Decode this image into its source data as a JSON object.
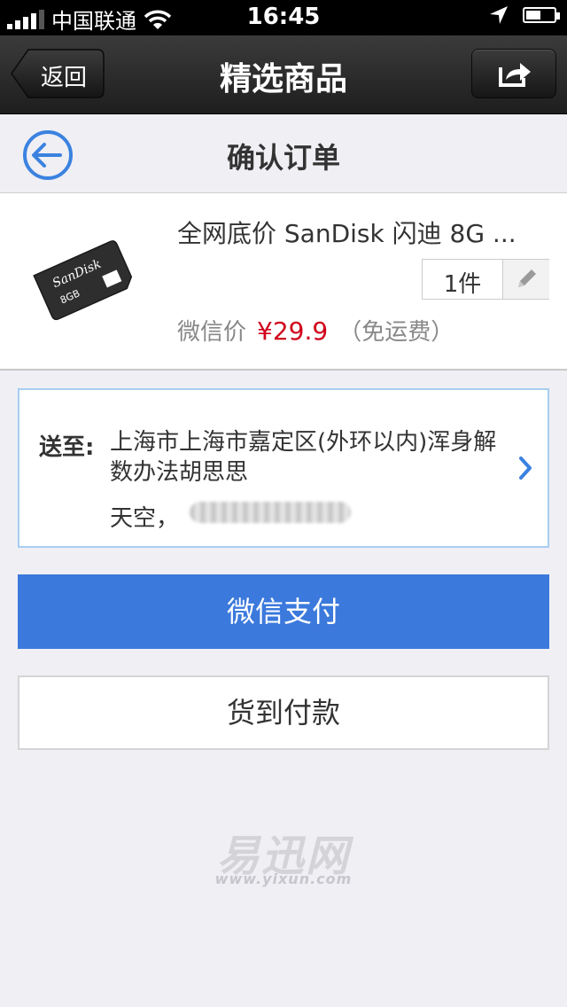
{
  "status_bar": {
    "carrier": "中国联通",
    "time": "16:45"
  },
  "nav": {
    "back_label": "返回",
    "title": "精选商品"
  },
  "header": {
    "title": "确认订单"
  },
  "product": {
    "title": "全网底价 SanDisk 闪迪 8G ...",
    "card_brand": "SanDisk",
    "card_capacity": "8GB",
    "quantity": "1件",
    "price_label": "微信价",
    "price": "¥29.9",
    "shipping": "（免运费）"
  },
  "address": {
    "label": "送至:",
    "text": "上海市上海市嘉定区(外环以内)浑身解数办法胡思思",
    "contact_name": "天空，"
  },
  "buttons": {
    "wechat_pay": "微信支付",
    "cash_on_delivery": "货到付款"
  },
  "watermark": {
    "logo": "易迅网",
    "url": "www.yixun.com"
  },
  "colors": {
    "accent_blue": "#3b79dc",
    "price_red": "#d0021b",
    "nav_dark": "#1e1e1e"
  }
}
